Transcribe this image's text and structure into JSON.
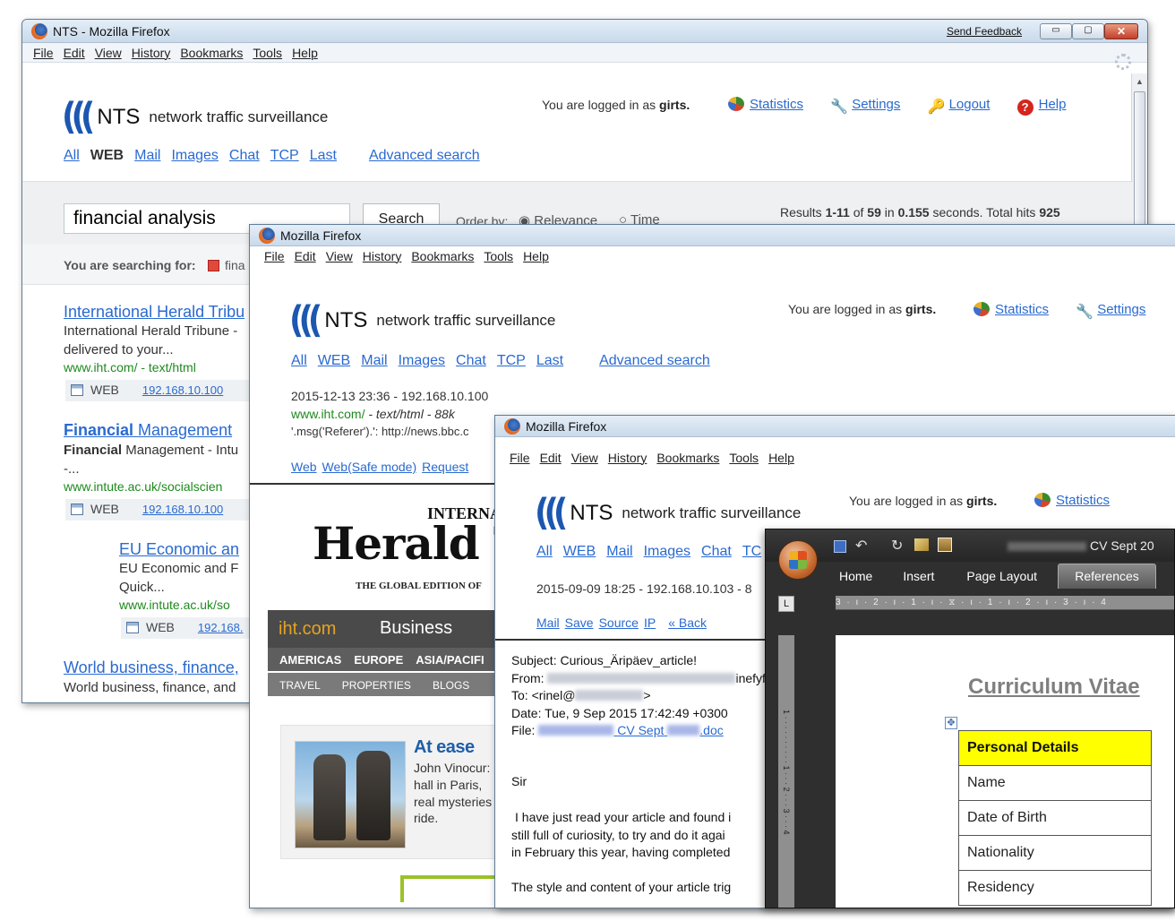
{
  "win1": {
    "title": "NTS - Mozilla Firefox",
    "send_feedback": "Send Feedback",
    "menu": [
      "File",
      "Edit",
      "View",
      "History",
      "Bookmarks",
      "Tools",
      "Help"
    ],
    "brand": {
      "nts": "NTS",
      "subtitle": "network traffic surveillance"
    },
    "logged_prefix": "You are logged in as",
    "user": "girts.",
    "toplinks": [
      "Statistics",
      "Settings",
      "Logout",
      "Help"
    ],
    "nav": {
      "all": "All",
      "web": "WEB",
      "mail": "Mail",
      "images": "Images",
      "chat": "Chat",
      "tcp": "TCP",
      "last": "Last",
      "advanced": "Advanced search"
    },
    "search_value": "financial analysis",
    "search_button": "Search",
    "order_by": "Order by:",
    "relevance": "Relevance",
    "time": "Time",
    "results": {
      "prefix": "Results",
      "range": "1-11",
      "of": "of",
      "count": "59",
      "in": "in",
      "secs": "0.155",
      "suffix": "seconds. Total hits",
      "hits": "925"
    },
    "searching_for": "You are searching for:",
    "searching_term": "fina",
    "items": [
      {
        "title": "International Herald Tribu",
        "desc1": "International Herald Tribune -",
        "desc2": "delivered to your...",
        "url": "www.iht.com/ - text/html",
        "type": "WEB",
        "ip": "192.168.10.100"
      },
      {
        "title_b": "Financial",
        "title_r": " Management",
        "desc_b": "Financial",
        "desc_r": " Management - Intu",
        "desc2": "-...",
        "url": "www.intute.ac.uk/socialscien",
        "type": "WEB",
        "ip": "192.168.10.100"
      },
      {
        "title": "EU Economic an",
        "desc1": "EU Economic and F",
        "desc2": "Quick...",
        "url": "www.intute.ac.uk/so",
        "type": "WEB",
        "ip": "192.168."
      },
      {
        "title": "World business, finance,",
        "desc1": "World business, finance, and"
      }
    ]
  },
  "win2": {
    "title": "Mozilla Firefox",
    "menu": [
      "File",
      "Edit",
      "View",
      "History",
      "Bookmarks",
      "Tools",
      "Help"
    ],
    "brand": {
      "nts": "NTS",
      "subtitle": "network traffic surveillance"
    },
    "logged_prefix": "You are logged in as",
    "user": "girts.",
    "toplinks": [
      "Statistics",
      "Settings"
    ],
    "nav": {
      "all": "All",
      "web": "WEB",
      "mail": "Mail",
      "images": "Images",
      "chat": "Chat",
      "tcp": "TCP",
      "last": "Last",
      "advanced": "Advanced search"
    },
    "meta": "2015-12-13 23:36 - 192.168.10.100",
    "url_line": "www.iht.com/",
    "url_type": "- text/html - 88k",
    "referer": "'.msg('Referer').': http://news.bbc.c",
    "actions": [
      "Web",
      "Web(Safe mode)",
      "Request"
    ],
    "iht": {
      "masthead_top": "INTERNA",
      "masthead": "Herald T",
      "edition": "THE GLOBAL EDITION OF",
      "site": "iht.com",
      "section": "Business",
      "nav1": [
        "AMERICAS",
        "EUROPE",
        "ASIA/PACIFI"
      ],
      "nav2": [
        "TRAVEL",
        "PROPERTIES",
        "BLOGS"
      ],
      "story_title": "At ease",
      "story_lines": [
        "John Vinocur:",
        "hall in Paris,",
        "real mysteries",
        "ride."
      ]
    }
  },
  "win3": {
    "title": "Mozilla Firefox",
    "menu": [
      "File",
      "Edit",
      "View",
      "History",
      "Bookmarks",
      "Tools",
      "Help"
    ],
    "brand": {
      "nts": "NTS",
      "subtitle": "network traffic surveillance"
    },
    "logged_prefix": "You are logged in as",
    "user": "girts.",
    "toplinks": [
      "Statistics"
    ],
    "nav": {
      "all": "All",
      "web": "WEB",
      "mail": "Mail",
      "images": "Images",
      "chat": "Chat",
      "tcp": "TC"
    },
    "meta": "2015-09-09 18:25 - 192.168.10.103 - 8",
    "actions": [
      "Mail",
      "Save",
      "Source",
      "IP",
      "« Back"
    ],
    "email": {
      "subject": "Subject: Curious_Äripäev_article!",
      "from_label": "From:",
      "from_tail": "inefyfe",
      "to_label": "To: <rinel@",
      "to_tail": ">",
      "date": "Date: Tue, 9 Sep 2015 17:42:49 +0300",
      "file_label": "File:",
      "file_link": "CV Sept",
      "file_ext": ".doc",
      "greeting": "Sir",
      "body": [
        "I have just read your article and found i",
        "still full of curiosity, to try and do it agai",
        "in February this year, having completed",
        "",
        "The style and content of your article trig"
      ]
    }
  },
  "word": {
    "doc_title": "CV Sept 20",
    "tabs": [
      "Home",
      "Insert",
      "Page Layout",
      "References"
    ],
    "heading": "Curriculum Vitae",
    "table_header": "Personal Details",
    "rows": [
      "Name",
      "Date of Birth",
      "Nationality",
      "Residency"
    ]
  }
}
